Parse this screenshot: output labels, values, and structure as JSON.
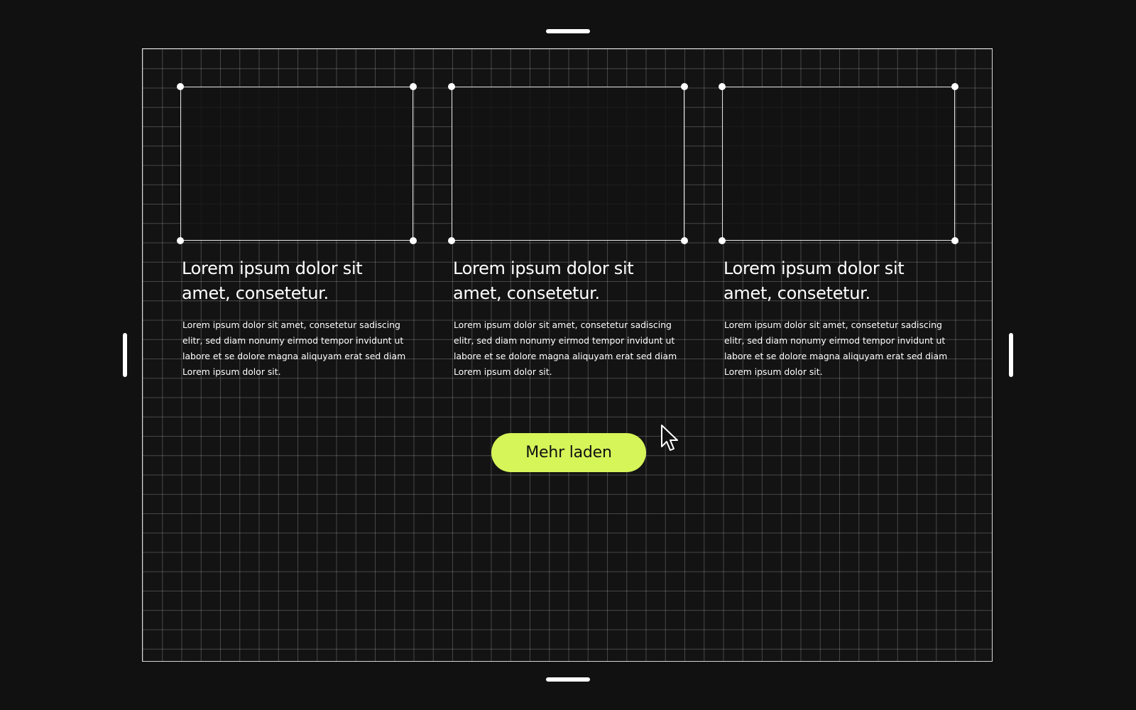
{
  "cards": [
    {
      "title": "Lorem ipsum dolor sit amet, consetetur.",
      "text": "Lorem ipsum dolor sit amet, consetetur sadiscing elitr, sed diam nonumy eirmod tempor invidunt ut labore et se dolore magna aliquyam erat sed diam Lorem ipsum dolor sit."
    },
    {
      "title": "Lorem ipsum dolor sit amet, consetetur.",
      "text": "Lorem ipsum dolor sit amet, consetetur sadiscing elitr, sed diam nonumy eirmod tempor invidunt ut labore et se dolore magna aliquyam erat sed diam Lorem ipsum dolor sit."
    },
    {
      "title": "Lorem ipsum dolor sit amet, consetetur.",
      "text": "Lorem ipsum dolor sit amet, consetetur sadiscing elitr, sed diam nonumy eirmod tempor invidunt ut labore et se dolore magna aliquyam erat sed diam Lorem ipsum dolor sit."
    }
  ],
  "load_more": {
    "label": "Mehr laden"
  },
  "icons": {
    "cursor": "mouse-pointer-icon",
    "corner": "selection-corner-handle"
  },
  "colors": {
    "background": "#111111",
    "accent": "#d5f558",
    "text": "#ffffff",
    "grid_line": "#3a3a3a"
  }
}
